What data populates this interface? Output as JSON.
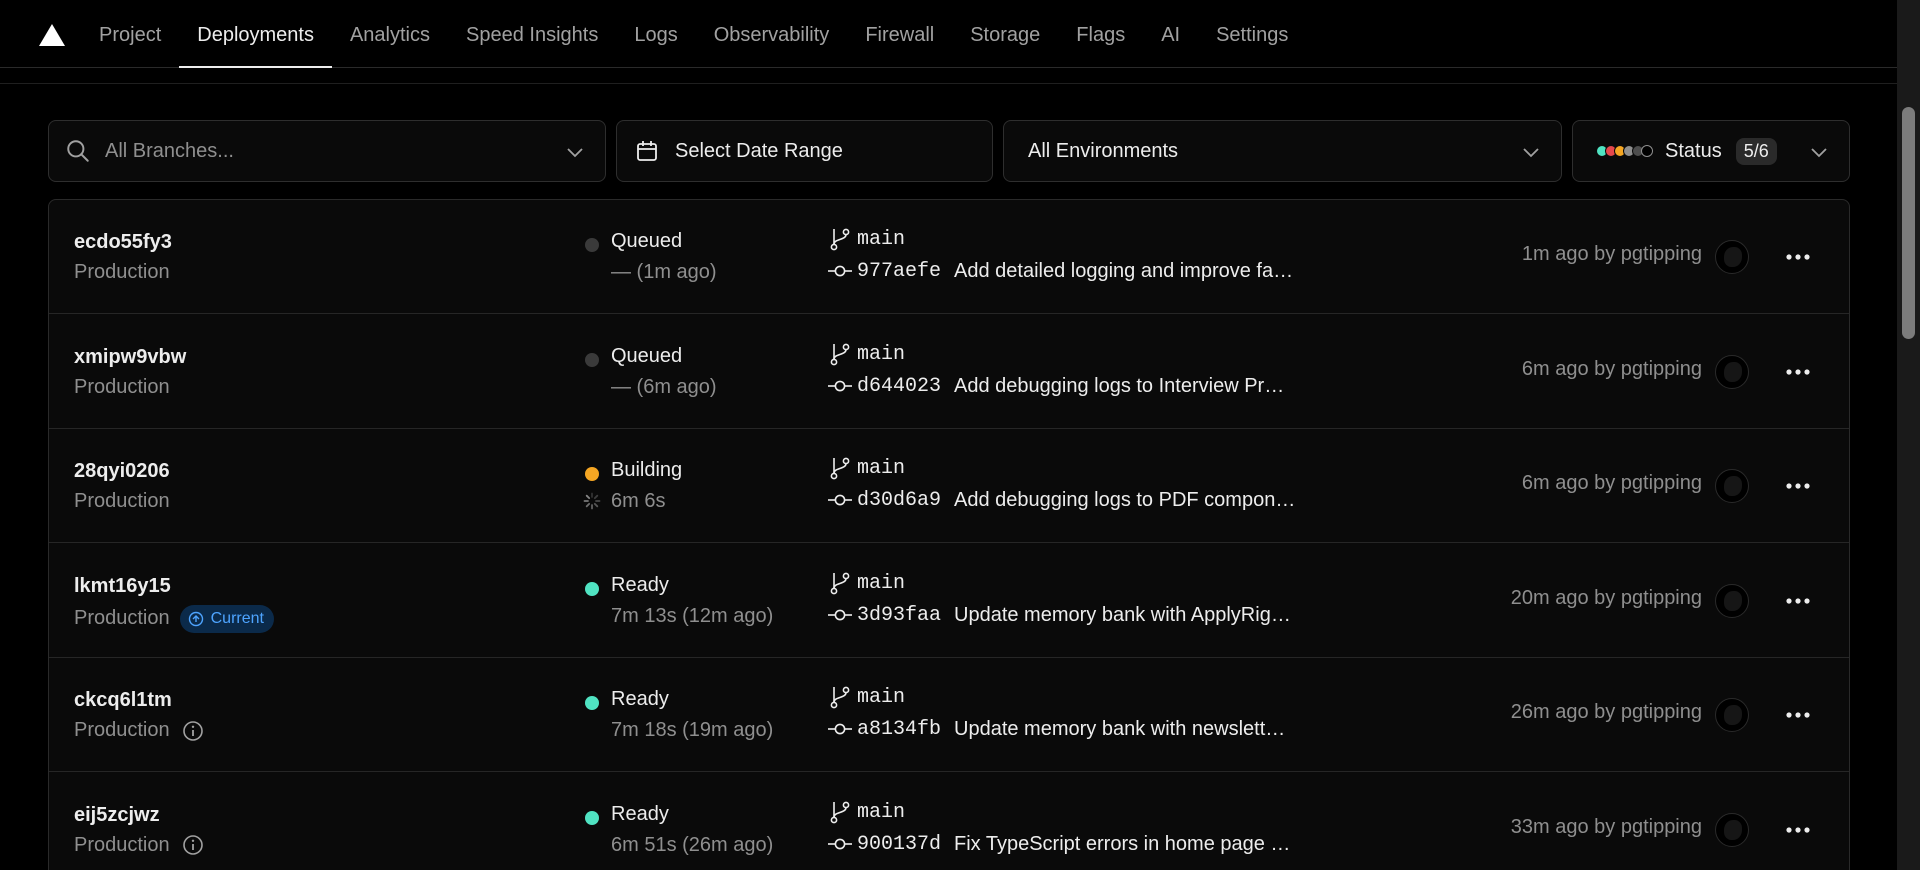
{
  "nav": {
    "tabs": [
      {
        "label": "Project"
      },
      {
        "label": "Deployments"
      },
      {
        "label": "Analytics"
      },
      {
        "label": "Speed Insights"
      },
      {
        "label": "Logs"
      },
      {
        "label": "Observability"
      },
      {
        "label": "Firewall"
      },
      {
        "label": "Storage"
      },
      {
        "label": "Flags"
      },
      {
        "label": "AI"
      },
      {
        "label": "Settings"
      }
    ],
    "active": "Deployments"
  },
  "filters": {
    "branch_placeholder": "All Branches...",
    "date_label": "Select Date Range",
    "environment_label": "All Environments",
    "status_label": "Status",
    "status_count": "5/6",
    "status_colors": [
      "#50e3c2",
      "#e5484d",
      "#f5a623",
      "#8f8f8f",
      "#4d4d4d",
      "#000000"
    ]
  },
  "colors": {
    "queued": "#3a3a3a",
    "building": "#f5a623",
    "ready": "#50e3c2",
    "current_badge": "#4ea4ff"
  },
  "deployments": [
    {
      "id": "ecdo55fy3",
      "environment": "Production",
      "env_tag": "",
      "status": "Queued",
      "status_color": "queued",
      "time": "— (1m ago)",
      "branch": "main",
      "sha": "977aefe",
      "message": "Add detailed logging and improve fa…",
      "meta": "1m ago by pgtipping"
    },
    {
      "id": "xmipw9vbw",
      "environment": "Production",
      "env_tag": "",
      "status": "Queued",
      "status_color": "queued",
      "time": "— (6m ago)",
      "branch": "main",
      "sha": "d644023",
      "message": "Add debugging logs to Interview Pr…",
      "meta": "6m ago by pgtipping"
    },
    {
      "id": "28qyi0206",
      "environment": "Production",
      "env_tag": "",
      "status": "Building",
      "status_color": "building",
      "time": "6m 6s",
      "branch": "main",
      "sha": "d30d6a9",
      "message": "Add debugging logs to PDF compon…",
      "meta": "6m ago by pgtipping"
    },
    {
      "id": "lkmt16y15",
      "environment": "Production",
      "env_tag": "Current",
      "status": "Ready",
      "status_color": "ready",
      "time": "7m 13s (12m ago)",
      "branch": "main",
      "sha": "3d93faa",
      "message": "Update memory bank with ApplyRig…",
      "meta": "20m ago by pgtipping"
    },
    {
      "id": "ckcq6l1tm",
      "environment": "Production",
      "env_tag": "info",
      "status": "Ready",
      "status_color": "ready",
      "time": "7m 18s (19m ago)",
      "branch": "main",
      "sha": "a8134fb",
      "message": "Update memory bank with newslett…",
      "meta": "26m ago by pgtipping"
    },
    {
      "id": "eij5zcjwz",
      "environment": "Production",
      "env_tag": "info",
      "status": "Ready",
      "status_color": "ready",
      "time": "6m 51s (26m ago)",
      "branch": "main",
      "sha": "900137d",
      "message": "Fix TypeScript errors in home page …",
      "meta": "33m ago by pgtipping"
    }
  ]
}
